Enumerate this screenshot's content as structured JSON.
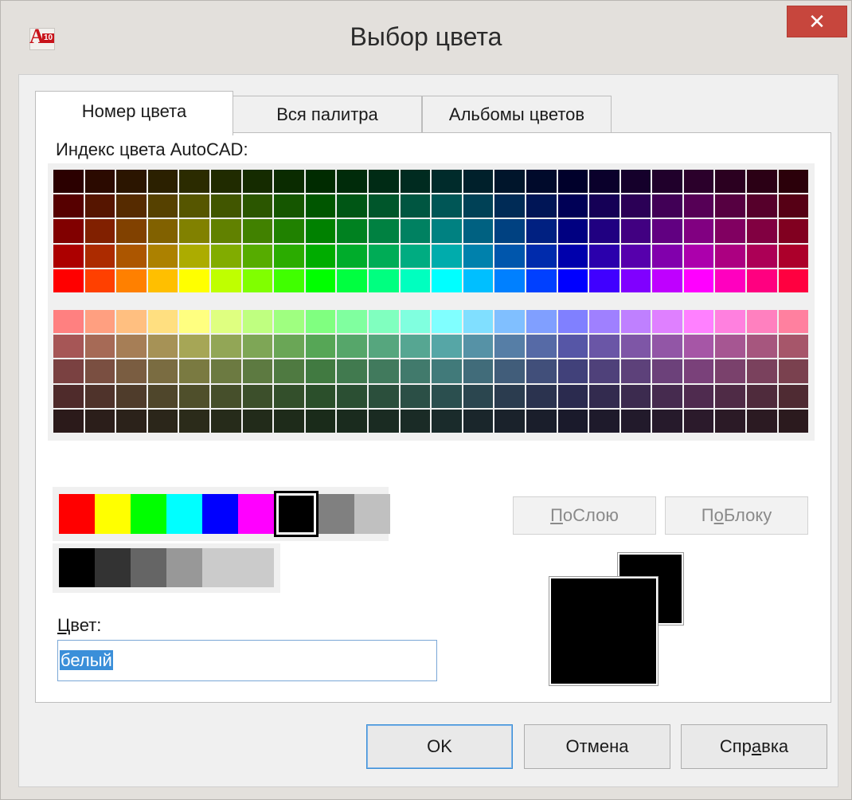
{
  "window": {
    "title": "Выбор цвета",
    "icon_text": "A",
    "icon_version": "10",
    "close_glyph": "✕"
  },
  "tabs": [
    {
      "label": "Номер цвета",
      "active": true
    },
    {
      "label": "Вся палитра",
      "active": false
    },
    {
      "label": "Альбомы цветов",
      "active": false
    }
  ],
  "aci": {
    "label": "Индекс цвета AutoCAD:",
    "top_block": [
      [
        "#2b0000",
        "#2b0a00",
        "#2b1500",
        "#2b2000",
        "#2b2b00",
        "#202b00",
        "#152b00",
        "#0a2b00",
        "#002b00",
        "#002b0a",
        "#002b15",
        "#002b20",
        "#002b2b",
        "#00202b",
        "#00152b",
        "#000a2b",
        "#00002b",
        "#0a002b",
        "#15002b",
        "#20002b",
        "#2b002b",
        "#2b0020",
        "#2b0015",
        "#2b000a"
      ],
      [
        "#560000",
        "#561500",
        "#562b00",
        "#564100",
        "#565600",
        "#415600",
        "#2b5600",
        "#155600",
        "#005600",
        "#005615",
        "#00562b",
        "#005641",
        "#005656",
        "#004156",
        "#002b56",
        "#001556",
        "#000056",
        "#150056",
        "#2b0056",
        "#410056",
        "#560056",
        "#560041",
        "#56002b",
        "#560015"
      ],
      [
        "#810000",
        "#812000",
        "#814100",
        "#816100",
        "#818100",
        "#618100",
        "#418100",
        "#208100",
        "#008100",
        "#008120",
        "#008141",
        "#008161",
        "#008181",
        "#006181",
        "#004181",
        "#002081",
        "#000081",
        "#200081",
        "#410081",
        "#610081",
        "#810081",
        "#810061",
        "#810041",
        "#810020"
      ],
      [
        "#ac0000",
        "#ac2b00",
        "#ac5600",
        "#ac8100",
        "#acac00",
        "#81ac00",
        "#56ac00",
        "#2bac00",
        "#00ac00",
        "#00ac2b",
        "#00ac56",
        "#00ac81",
        "#00acac",
        "#0081ac",
        "#0056ac",
        "#002bac",
        "#0000ac",
        "#2b00ac",
        "#5600ac",
        "#8100ac",
        "#ac00ac",
        "#ac0081",
        "#ac0056",
        "#ac002b"
      ],
      [
        "#ff0000",
        "#ff4000",
        "#ff8000",
        "#ffbf00",
        "#ffff00",
        "#bfff00",
        "#80ff00",
        "#40ff00",
        "#00ff00",
        "#00ff40",
        "#00ff80",
        "#00ffbf",
        "#00ffff",
        "#00bfff",
        "#0080ff",
        "#0040ff",
        "#0000ff",
        "#4000ff",
        "#8000ff",
        "#bf00ff",
        "#ff00ff",
        "#ff00bf",
        "#ff0080",
        "#ff0040"
      ]
    ],
    "bottom_block": [
      [
        "#ff8080",
        "#ff9f80",
        "#ffbf80",
        "#ffdf80",
        "#ffff80",
        "#dfff80",
        "#bfff80",
        "#9fff80",
        "#80ff80",
        "#80ff9f",
        "#80ffbf",
        "#80ffdf",
        "#80ffff",
        "#80dfff",
        "#80bfff",
        "#809fff",
        "#8080ff",
        "#9f80ff",
        "#bf80ff",
        "#df80ff",
        "#ff80ff",
        "#ff80df",
        "#ff80bf",
        "#ff809f"
      ],
      [
        "#a65656",
        "#a66a56",
        "#a67e56",
        "#a69256",
        "#a6a656",
        "#92a656",
        "#7ea656",
        "#6aa656",
        "#56a656",
        "#56a66a",
        "#56a67e",
        "#56a692",
        "#56a6a6",
        "#5692a6",
        "#567ea6",
        "#566aa6",
        "#5656a6",
        "#6a56a6",
        "#7e56a6",
        "#9256a6",
        "#a656a6",
        "#a65692",
        "#a6567e",
        "#a6566a"
      ],
      [
        "#7a4141",
        "#7a4f41",
        "#7a5d41",
        "#7a6c41",
        "#7a7a41",
        "#6c7a41",
        "#5d7a41",
        "#4f7a41",
        "#417a41",
        "#417a4f",
        "#417a5d",
        "#417a6c",
        "#417a7a",
        "#416c7a",
        "#415d7a",
        "#414f7a",
        "#41417a",
        "#4f417a",
        "#5d417a",
        "#6c417a",
        "#7a417a",
        "#7a416c",
        "#7a415d",
        "#7a414f"
      ],
      [
        "#4f2b2b",
        "#4f332b",
        "#4f3c2b",
        "#4f462b",
        "#4f4f2b",
        "#464f2b",
        "#3c4f2b",
        "#334f2b",
        "#2b4f2b",
        "#2b4f33",
        "#2b4f3c",
        "#2b4f46",
        "#2b4f4f",
        "#2b464f",
        "#2b3c4f",
        "#2b334f",
        "#2b2b4f",
        "#332b4f",
        "#3c2b4f",
        "#462b4f",
        "#4f2b4f",
        "#4f2b46",
        "#4f2b3c",
        "#4f2b33"
      ],
      [
        "#2b1a1a",
        "#2b1e1a",
        "#2b221a",
        "#2b261a",
        "#2b2b1a",
        "#262b1a",
        "#222b1a",
        "#1e2b1a",
        "#1a2b1a",
        "#1a2b1e",
        "#1a2b22",
        "#1a2b26",
        "#1a2b2b",
        "#1a262b",
        "#1a222b",
        "#1a1e2b",
        "#1a1a2b",
        "#1e1a2b",
        "#221a2b",
        "#261a2b",
        "#2b1a2b",
        "#2b1a26",
        "#2b1a22",
        "#2b1a1e"
      ]
    ]
  },
  "standard_colors": [
    "#ff0000",
    "#ffff00",
    "#00ff00",
    "#00ffff",
    "#0000ff",
    "#ff00ff",
    "#000000",
    "#808080",
    "#c0c0c0"
  ],
  "selected_standard_index": 6,
  "gray_colors": [
    "#000000",
    "#333333",
    "#656565",
    "#989898",
    "#cbcbcb",
    "#cbcbcb"
  ],
  "bylayer": {
    "pre": "",
    "hot": "П",
    "post": "оСлою"
  },
  "byblock": {
    "pre": "П",
    "hot": "о",
    "post": "Блоку"
  },
  "color_field": {
    "label_hot": "Ц",
    "label_rest": "вет:",
    "value": "белый"
  },
  "buttons": {
    "ok": "OK",
    "cancel": "Отмена",
    "help_pre": "Спр",
    "help_hot": "а",
    "help_post": "вка"
  }
}
